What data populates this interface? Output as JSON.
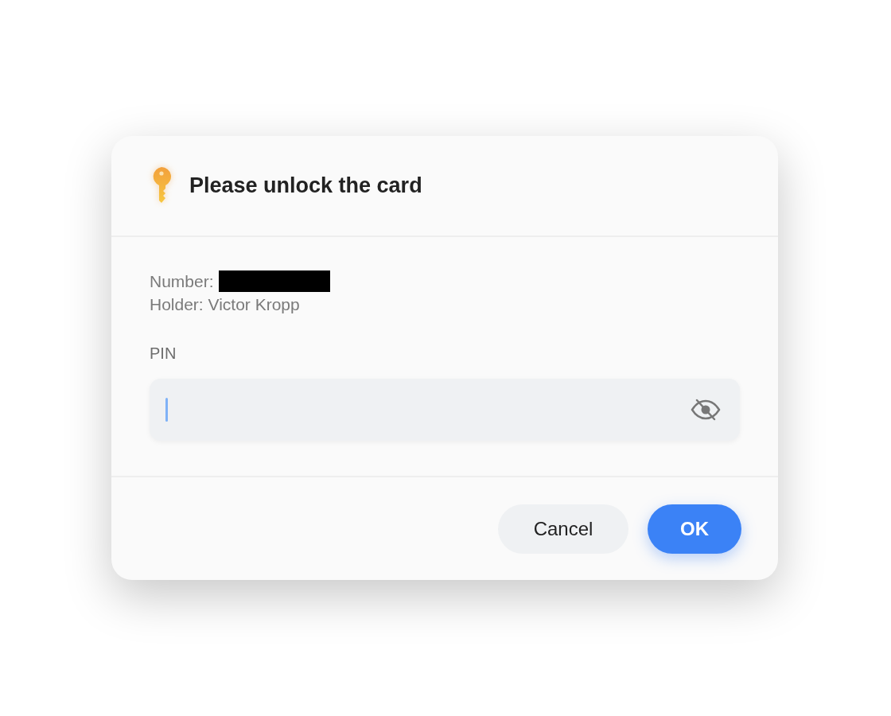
{
  "dialog": {
    "title": "Please unlock the card",
    "details": [
      {
        "label": "Number:",
        "value_redacted": true
      },
      {
        "label": "Holder: Victor Kropp",
        "value_redacted": false
      }
    ],
    "pin": {
      "label": "PIN",
      "focused": true,
      "revealed": false
    },
    "buttons": [
      {
        "label": "Cancel",
        "kind": "secondary"
      },
      {
        "label": "OK",
        "kind": "primary"
      }
    ]
  }
}
